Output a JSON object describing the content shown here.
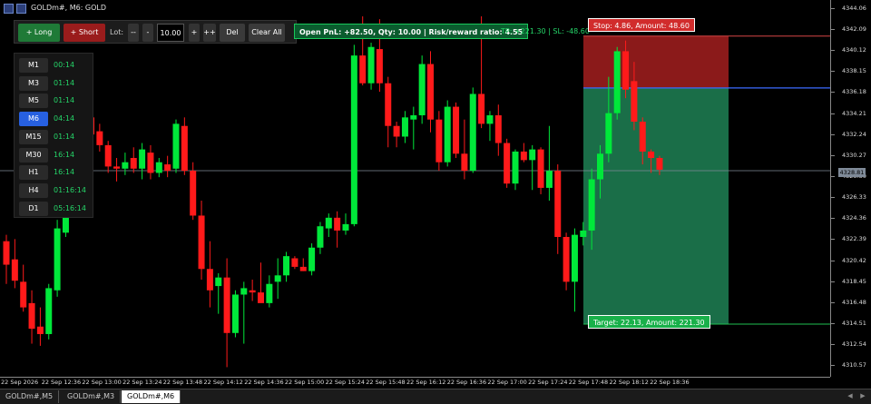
{
  "window": {
    "title": "GOLDm#, M6:  GOLD"
  },
  "toolbar": {
    "long_label": "+ Long",
    "short_label": "+ Short",
    "lot_label": "Lot:",
    "lot_minus2": "--",
    "lot_minus": "-",
    "lot_value": "10.00",
    "lot_plus": "+",
    "lot_plus2": "++",
    "del_label": "Del",
    "clear_label": "Clear All"
  },
  "status": {
    "summary": "Open PnL: +82.50, Qty: 10.00 | Risk/reward ratio: 4.55",
    "tp_sl": "TP: +221.30 | SL: -48.60"
  },
  "timeframes": [
    {
      "label": "M1",
      "countdown": "00:14",
      "active": false
    },
    {
      "label": "M3",
      "countdown": "01:14",
      "active": false
    },
    {
      "label": "M5",
      "countdown": "01:14",
      "active": false
    },
    {
      "label": "M6",
      "countdown": "04:14",
      "active": true
    },
    {
      "label": "M15",
      "countdown": "01:14",
      "active": false
    },
    {
      "label": "M30",
      "countdown": "16:14",
      "active": false
    },
    {
      "label": "H1",
      "countdown": "16:14",
      "active": false
    },
    {
      "label": "H4",
      "countdown": "01:16:14",
      "active": false
    },
    {
      "label": "D1",
      "countdown": "05:16:14",
      "active": false
    }
  ],
  "position": {
    "stop_label": "Stop: 4.86, Amount: 48.60",
    "target_label": "Target: 22.13, Amount: 221.30",
    "entry_price": 4336.56,
    "stop_price": 4341.42,
    "target_price": 4314.43,
    "stop_color": "#8b1a1a",
    "target_color": "#1a6e48"
  },
  "current_price": "4328.81",
  "colors": {
    "bull": "#00e83a",
    "bear": "#ff1a1a",
    "background": "#000000"
  },
  "chart_data": {
    "type": "candlestick",
    "price_axis_labels": [
      "4344.06",
      "4342.09",
      "4340.12",
      "4338.15",
      "4336.18",
      "4334.21",
      "4332.24",
      "4330.27",
      "4328.30",
      "4326.33",
      "4324.36",
      "4322.39",
      "4320.42",
      "4318.45",
      "4316.48",
      "4314.51",
      "4312.54",
      "4310.57"
    ],
    "ylim": [
      4309.5,
      4344.8
    ],
    "time_labels": [
      "22 Sep 2026",
      "22 Sep 12:36",
      "22 Sep 13:00",
      "22 Sep 13:24",
      "22 Sep 13:48",
      "22 Sep 14:12",
      "22 Sep 14:36",
      "22 Sep 15:00",
      "22 Sep 15:24",
      "22 Sep 15:48",
      "22 Sep 16:12",
      "22 Sep 16:36",
      "22 Sep 17:00",
      "22 Sep 17:24",
      "22 Sep 17:48",
      "22 Sep 18:12",
      "22 Sep 18:36"
    ],
    "candles": [
      {
        "o": 4322.2,
        "h": 4322.8,
        "l": 4318.2,
        "c": 4320.0
      },
      {
        "o": 4320.5,
        "h": 4322.4,
        "l": 4317.8,
        "c": 4318.5
      },
      {
        "o": 4318.4,
        "h": 4320.0,
        "l": 4315.6,
        "c": 4316.0
      },
      {
        "o": 4316.4,
        "h": 4317.6,
        "l": 4312.6,
        "c": 4314.0
      },
      {
        "o": 4314.2,
        "h": 4316.0,
        "l": 4312.4,
        "c": 4313.5
      },
      {
        "o": 4313.5,
        "h": 4318.2,
        "l": 4313.0,
        "c": 4317.8
      },
      {
        "o": 4317.6,
        "h": 4324.2,
        "l": 4317.0,
        "c": 4323.4
      },
      {
        "o": 4323.0,
        "h": 4329.4,
        "l": 4322.6,
        "c": 4328.0
      },
      {
        "o": 4328.0,
        "h": 4332.0,
        "l": 4326.4,
        "c": 4331.0
      },
      {
        "o": 4331.5,
        "h": 4335.2,
        "l": 4331.0,
        "c": 4334.0
      },
      {
        "o": 4333.8,
        "h": 4334.0,
        "l": 4331.4,
        "c": 4332.2
      },
      {
        "o": 4332.5,
        "h": 4333.2,
        "l": 4330.6,
        "c": 4331.2
      },
      {
        "o": 4331.2,
        "h": 4331.6,
        "l": 4328.6,
        "c": 4329.2
      },
      {
        "o": 4329.2,
        "h": 4330.0,
        "l": 4327.8,
        "c": 4329.0
      },
      {
        "o": 4329.0,
        "h": 4330.5,
        "l": 4328.4,
        "c": 4329.6
      },
      {
        "o": 4330.0,
        "h": 4331.0,
        "l": 4328.6,
        "c": 4329.0
      },
      {
        "o": 4329.0,
        "h": 4331.4,
        "l": 4328.0,
        "c": 4330.8
      },
      {
        "o": 4330.5,
        "h": 4331.2,
        "l": 4328.0,
        "c": 4328.6
      },
      {
        "o": 4328.6,
        "h": 4330.0,
        "l": 4328.2,
        "c": 4329.6
      },
      {
        "o": 4329.4,
        "h": 4330.2,
        "l": 4328.2,
        "c": 4328.8
      },
      {
        "o": 4329.0,
        "h": 4333.6,
        "l": 4328.6,
        "c": 4333.2
      },
      {
        "o": 4333.0,
        "h": 4333.8,
        "l": 4328.4,
        "c": 4328.8
      },
      {
        "o": 4328.8,
        "h": 4329.6,
        "l": 4324.2,
        "c": 4324.6
      },
      {
        "o": 4324.6,
        "h": 4326.0,
        "l": 4318.6,
        "c": 4319.6
      },
      {
        "o": 4319.6,
        "h": 4322.2,
        "l": 4316.0,
        "c": 4317.6
      },
      {
        "o": 4318.0,
        "h": 4319.2,
        "l": 4315.4,
        "c": 4318.8
      },
      {
        "o": 4318.8,
        "h": 4320.6,
        "l": 4310.4,
        "c": 4313.6
      },
      {
        "o": 4313.6,
        "h": 4317.6,
        "l": 4313.2,
        "c": 4317.2
      },
      {
        "o": 4317.2,
        "h": 4318.4,
        "l": 4312.6,
        "c": 4317.8
      },
      {
        "o": 4317.6,
        "h": 4318.6,
        "l": 4316.6,
        "c": 4317.4
      },
      {
        "o": 4317.4,
        "h": 4320.2,
        "l": 4317.0,
        "c": 4316.4
      },
      {
        "o": 4316.4,
        "h": 4319.0,
        "l": 4316.0,
        "c": 4318.2
      },
      {
        "o": 4318.4,
        "h": 4320.6,
        "l": 4316.8,
        "c": 4319.0
      },
      {
        "o": 4319.0,
        "h": 4321.2,
        "l": 4318.4,
        "c": 4320.8
      },
      {
        "o": 4320.6,
        "h": 4320.8,
        "l": 4319.6,
        "c": 4319.8
      },
      {
        "o": 4319.8,
        "h": 4320.6,
        "l": 4319.4,
        "c": 4319.4
      },
      {
        "o": 4319.4,
        "h": 4322.0,
        "l": 4319.0,
        "c": 4321.6
      },
      {
        "o": 4321.6,
        "h": 4324.0,
        "l": 4321.0,
        "c": 4323.6
      },
      {
        "o": 4323.4,
        "h": 4324.8,
        "l": 4322.6,
        "c": 4324.4
      },
      {
        "o": 4324.4,
        "h": 4325.0,
        "l": 4321.6,
        "c": 4323.2
      },
      {
        "o": 4323.2,
        "h": 4324.8,
        "l": 4322.8,
        "c": 4323.8
      },
      {
        "o": 4323.8,
        "h": 4340.6,
        "l": 4323.6,
        "c": 4339.6
      },
      {
        "o": 4339.6,
        "h": 4344.0,
        "l": 4336.8,
        "c": 4337.0
      },
      {
        "o": 4337.0,
        "h": 4340.8,
        "l": 4336.4,
        "c": 4340.4
      },
      {
        "o": 4340.2,
        "h": 4343.0,
        "l": 4336.2,
        "c": 4337.0
      },
      {
        "o": 4337.0,
        "h": 4337.6,
        "l": 4331.0,
        "c": 4333.0
      },
      {
        "o": 4333.0,
        "h": 4333.4,
        "l": 4331.0,
        "c": 4332.0
      },
      {
        "o": 4332.0,
        "h": 4334.4,
        "l": 4331.4,
        "c": 4333.8
      },
      {
        "o": 4333.6,
        "h": 4334.8,
        "l": 4330.8,
        "c": 4334.0
      },
      {
        "o": 4334.0,
        "h": 4339.6,
        "l": 4333.2,
        "c": 4338.8
      },
      {
        "o": 4338.8,
        "h": 4340.0,
        "l": 4332.4,
        "c": 4333.6
      },
      {
        "o": 4333.6,
        "h": 4334.4,
        "l": 4328.8,
        "c": 4329.6
      },
      {
        "o": 4329.6,
        "h": 4335.4,
        "l": 4329.2,
        "c": 4334.8
      },
      {
        "o": 4334.8,
        "h": 4335.2,
        "l": 4330.0,
        "c": 4330.4
      },
      {
        "o": 4330.4,
        "h": 4333.6,
        "l": 4328.0,
        "c": 4328.8
      },
      {
        "o": 4328.8,
        "h": 4336.6,
        "l": 4328.6,
        "c": 4336.0
      },
      {
        "o": 4336.0,
        "h": 4344.0,
        "l": 4332.8,
        "c": 4333.2
      },
      {
        "o": 4333.2,
        "h": 4334.4,
        "l": 4331.6,
        "c": 4334.0
      },
      {
        "o": 4334.0,
        "h": 4335.0,
        "l": 4330.2,
        "c": 4331.4
      },
      {
        "o": 4331.4,
        "h": 4331.8,
        "l": 4327.2,
        "c": 4327.6
      },
      {
        "o": 4327.6,
        "h": 4330.8,
        "l": 4327.0,
        "c": 4330.6
      },
      {
        "o": 4330.6,
        "h": 4331.4,
        "l": 4329.6,
        "c": 4329.8
      },
      {
        "o": 4329.8,
        "h": 4331.2,
        "l": 4327.0,
        "c": 4330.8
      },
      {
        "o": 4330.8,
        "h": 4331.0,
        "l": 4326.6,
        "c": 4327.2
      },
      {
        "o": 4327.2,
        "h": 4333.0,
        "l": 4326.0,
        "c": 4328.8
      },
      {
        "o": 4328.8,
        "h": 4329.4,
        "l": 4321.0,
        "c": 4322.6
      },
      {
        "o": 4322.6,
        "h": 4323.0,
        "l": 4317.6,
        "c": 4318.4
      },
      {
        "o": 4318.4,
        "h": 4323.4,
        "l": 4315.6,
        "c": 4322.8
      },
      {
        "o": 4322.6,
        "h": 4324.0,
        "l": 4321.8,
        "c": 4323.2
      },
      {
        "o": 4323.2,
        "h": 4329.0,
        "l": 4321.4,
        "c": 4328.0
      },
      {
        "o": 4328.0,
        "h": 4331.2,
        "l": 4326.2,
        "c": 4330.4
      },
      {
        "o": 4330.4,
        "h": 4337.6,
        "l": 4329.6,
        "c": 4334.2
      },
      {
        "o": 4334.2,
        "h": 4340.4,
        "l": 4333.6,
        "c": 4340.0
      },
      {
        "o": 4340.0,
        "h": 4341.0,
        "l": 4335.6,
        "c": 4336.4
      },
      {
        "o": 4337.2,
        "h": 4339.0,
        "l": 4332.6,
        "c": 4333.4
      },
      {
        "o": 4333.4,
        "h": 4333.8,
        "l": 4329.4,
        "c": 4330.6
      },
      {
        "o": 4330.6,
        "h": 4330.8,
        "l": 4328.6,
        "c": 4330.0
      },
      {
        "o": 4330.0,
        "h": 4330.2,
        "l": 4328.4,
        "c": 4328.9
      }
    ]
  },
  "tabs": [
    {
      "label": "GOLDm#,M5",
      "active": false
    },
    {
      "label": "GOLDm#,M3",
      "active": false
    },
    {
      "label": "GOLDm#,M6",
      "active": true
    }
  ]
}
